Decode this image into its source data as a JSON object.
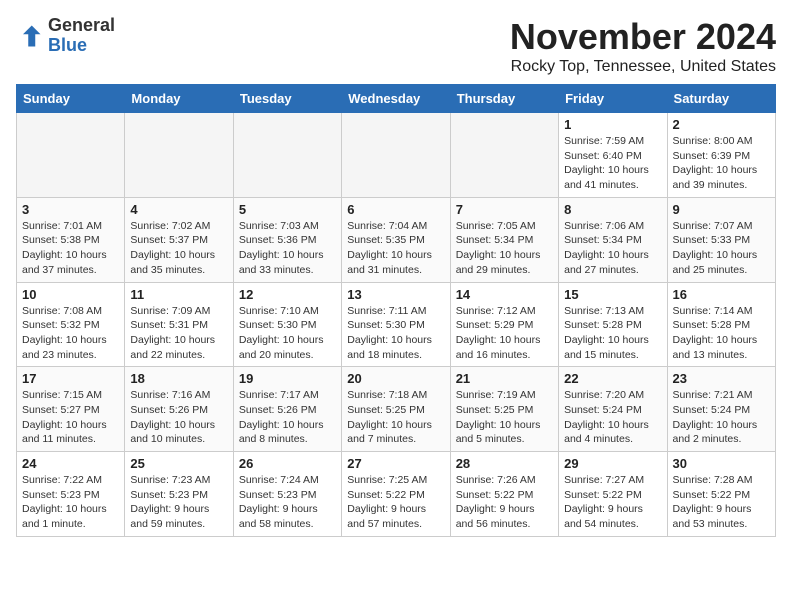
{
  "logo": {
    "general": "General",
    "blue": "Blue"
  },
  "title": "November 2024",
  "location": "Rocky Top, Tennessee, United States",
  "weekdays": [
    "Sunday",
    "Monday",
    "Tuesday",
    "Wednesday",
    "Thursday",
    "Friday",
    "Saturday"
  ],
  "weeks": [
    [
      {
        "day": "",
        "empty": true
      },
      {
        "day": "",
        "empty": true
      },
      {
        "day": "",
        "empty": true
      },
      {
        "day": "",
        "empty": true
      },
      {
        "day": "",
        "empty": true
      },
      {
        "day": "1",
        "sunrise": "Sunrise: 7:59 AM",
        "sunset": "Sunset: 6:40 PM",
        "daylight": "Daylight: 10 hours and 41 minutes."
      },
      {
        "day": "2",
        "sunrise": "Sunrise: 8:00 AM",
        "sunset": "Sunset: 6:39 PM",
        "daylight": "Daylight: 10 hours and 39 minutes."
      }
    ],
    [
      {
        "day": "3",
        "sunrise": "Sunrise: 7:01 AM",
        "sunset": "Sunset: 5:38 PM",
        "daylight": "Daylight: 10 hours and 37 minutes."
      },
      {
        "day": "4",
        "sunrise": "Sunrise: 7:02 AM",
        "sunset": "Sunset: 5:37 PM",
        "daylight": "Daylight: 10 hours and 35 minutes."
      },
      {
        "day": "5",
        "sunrise": "Sunrise: 7:03 AM",
        "sunset": "Sunset: 5:36 PM",
        "daylight": "Daylight: 10 hours and 33 minutes."
      },
      {
        "day": "6",
        "sunrise": "Sunrise: 7:04 AM",
        "sunset": "Sunset: 5:35 PM",
        "daylight": "Daylight: 10 hours and 31 minutes."
      },
      {
        "day": "7",
        "sunrise": "Sunrise: 7:05 AM",
        "sunset": "Sunset: 5:34 PM",
        "daylight": "Daylight: 10 hours and 29 minutes."
      },
      {
        "day": "8",
        "sunrise": "Sunrise: 7:06 AM",
        "sunset": "Sunset: 5:34 PM",
        "daylight": "Daylight: 10 hours and 27 minutes."
      },
      {
        "day": "9",
        "sunrise": "Sunrise: 7:07 AM",
        "sunset": "Sunset: 5:33 PM",
        "daylight": "Daylight: 10 hours and 25 minutes."
      }
    ],
    [
      {
        "day": "10",
        "sunrise": "Sunrise: 7:08 AM",
        "sunset": "Sunset: 5:32 PM",
        "daylight": "Daylight: 10 hours and 23 minutes."
      },
      {
        "day": "11",
        "sunrise": "Sunrise: 7:09 AM",
        "sunset": "Sunset: 5:31 PM",
        "daylight": "Daylight: 10 hours and 22 minutes."
      },
      {
        "day": "12",
        "sunrise": "Sunrise: 7:10 AM",
        "sunset": "Sunset: 5:30 PM",
        "daylight": "Daylight: 10 hours and 20 minutes."
      },
      {
        "day": "13",
        "sunrise": "Sunrise: 7:11 AM",
        "sunset": "Sunset: 5:30 PM",
        "daylight": "Daylight: 10 hours and 18 minutes."
      },
      {
        "day": "14",
        "sunrise": "Sunrise: 7:12 AM",
        "sunset": "Sunset: 5:29 PM",
        "daylight": "Daylight: 10 hours and 16 minutes."
      },
      {
        "day": "15",
        "sunrise": "Sunrise: 7:13 AM",
        "sunset": "Sunset: 5:28 PM",
        "daylight": "Daylight: 10 hours and 15 minutes."
      },
      {
        "day": "16",
        "sunrise": "Sunrise: 7:14 AM",
        "sunset": "Sunset: 5:28 PM",
        "daylight": "Daylight: 10 hours and 13 minutes."
      }
    ],
    [
      {
        "day": "17",
        "sunrise": "Sunrise: 7:15 AM",
        "sunset": "Sunset: 5:27 PM",
        "daylight": "Daylight: 10 hours and 11 minutes."
      },
      {
        "day": "18",
        "sunrise": "Sunrise: 7:16 AM",
        "sunset": "Sunset: 5:26 PM",
        "daylight": "Daylight: 10 hours and 10 minutes."
      },
      {
        "day": "19",
        "sunrise": "Sunrise: 7:17 AM",
        "sunset": "Sunset: 5:26 PM",
        "daylight": "Daylight: 10 hours and 8 minutes."
      },
      {
        "day": "20",
        "sunrise": "Sunrise: 7:18 AM",
        "sunset": "Sunset: 5:25 PM",
        "daylight": "Daylight: 10 hours and 7 minutes."
      },
      {
        "day": "21",
        "sunrise": "Sunrise: 7:19 AM",
        "sunset": "Sunset: 5:25 PM",
        "daylight": "Daylight: 10 hours and 5 minutes."
      },
      {
        "day": "22",
        "sunrise": "Sunrise: 7:20 AM",
        "sunset": "Sunset: 5:24 PM",
        "daylight": "Daylight: 10 hours and 4 minutes."
      },
      {
        "day": "23",
        "sunrise": "Sunrise: 7:21 AM",
        "sunset": "Sunset: 5:24 PM",
        "daylight": "Daylight: 10 hours and 2 minutes."
      }
    ],
    [
      {
        "day": "24",
        "sunrise": "Sunrise: 7:22 AM",
        "sunset": "Sunset: 5:23 PM",
        "daylight": "Daylight: 10 hours and 1 minute."
      },
      {
        "day": "25",
        "sunrise": "Sunrise: 7:23 AM",
        "sunset": "Sunset: 5:23 PM",
        "daylight": "Daylight: 9 hours and 59 minutes."
      },
      {
        "day": "26",
        "sunrise": "Sunrise: 7:24 AM",
        "sunset": "Sunset: 5:23 PM",
        "daylight": "Daylight: 9 hours and 58 minutes."
      },
      {
        "day": "27",
        "sunrise": "Sunrise: 7:25 AM",
        "sunset": "Sunset: 5:22 PM",
        "daylight": "Daylight: 9 hours and 57 minutes."
      },
      {
        "day": "28",
        "sunrise": "Sunrise: 7:26 AM",
        "sunset": "Sunset: 5:22 PM",
        "daylight": "Daylight: 9 hours and 56 minutes."
      },
      {
        "day": "29",
        "sunrise": "Sunrise: 7:27 AM",
        "sunset": "Sunset: 5:22 PM",
        "daylight": "Daylight: 9 hours and 54 minutes."
      },
      {
        "day": "30",
        "sunrise": "Sunrise: 7:28 AM",
        "sunset": "Sunset: 5:22 PM",
        "daylight": "Daylight: 9 hours and 53 minutes."
      }
    ]
  ]
}
